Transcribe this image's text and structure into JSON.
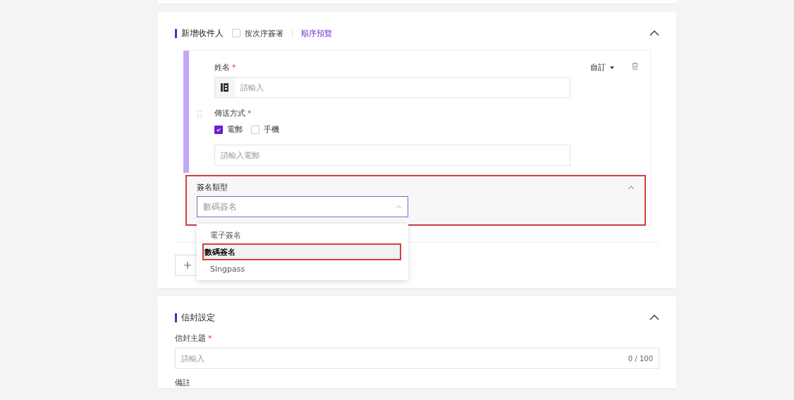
{
  "recipients": {
    "title": "新增收件人",
    "sequential": {
      "label": "按次序簽署",
      "checked": false
    },
    "preview_link": "順序預覽",
    "expanded": true,
    "recipient": {
      "name_label": "姓名",
      "name_required_mark": "*",
      "name_placeholder": "請輸入",
      "role": "自訂",
      "method_label": "傳送方式",
      "method_required_mark": "*",
      "methods": [
        {
          "label": "電郵",
          "checked": true
        },
        {
          "label": "手機",
          "checked": false
        }
      ],
      "email_placeholder": "請輸入電郵",
      "signature": {
        "label": "簽名類型",
        "value": "數碼簽名",
        "open": true,
        "highlighted": true,
        "options": [
          {
            "label": "電子簽名",
            "selected": false,
            "highlighted": false
          },
          {
            "label": "數碼簽名",
            "selected": true,
            "highlighted": true
          },
          {
            "label": "Singpass",
            "selected": false,
            "highlighted": false
          }
        ]
      }
    }
  },
  "envelope": {
    "title": "信封設定",
    "expanded": true,
    "subject_label": "信封主題",
    "subject_required_mark": "*",
    "subject_placeholder": "請輸入",
    "subject_counter": "0 / 100",
    "note_label": "備註"
  }
}
